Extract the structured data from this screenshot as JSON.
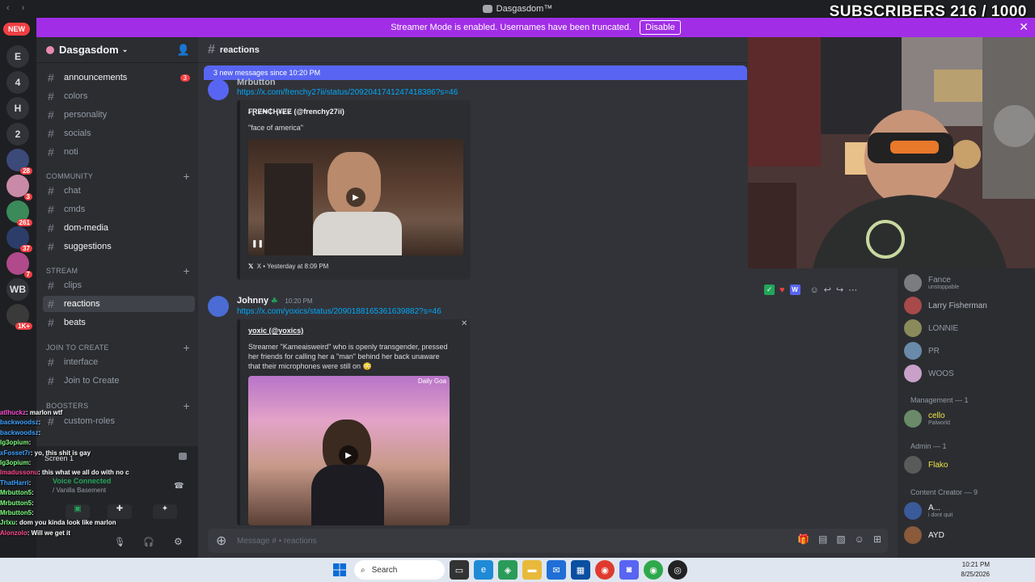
{
  "window": {
    "title": "Dasgasdom™"
  },
  "overlay": {
    "subscribers_text": "SUBSCRIBERS 216 / 1000"
  },
  "banner": {
    "text": "Streamer Mode is enabled. Usernames have been truncated.",
    "button": "Disable"
  },
  "rail": {
    "new_label": "NEW",
    "servers": [
      {
        "label": "E",
        "badge": ""
      },
      {
        "label": "4",
        "badge": ""
      },
      {
        "label": "H",
        "badge": ""
      },
      {
        "label": "2",
        "badge": ""
      },
      {
        "label": "",
        "badge": "28"
      },
      {
        "label": "",
        "badge": "3"
      },
      {
        "label": "",
        "badge": "261"
      },
      {
        "label": "",
        "badge": "37"
      },
      {
        "label": "",
        "badge": "7"
      },
      {
        "label": "WB",
        "badge": ""
      },
      {
        "label": "",
        "badge": "1K+"
      }
    ]
  },
  "sidebar": {
    "server_name": "Dasgasdom",
    "channels_top": [
      {
        "name": "announcements",
        "unread": true,
        "badge": "3"
      },
      {
        "name": "colors",
        "unread": false,
        "badge": ""
      },
      {
        "name": "personality",
        "unread": false,
        "badge": ""
      },
      {
        "name": "socials",
        "unread": false,
        "badge": ""
      },
      {
        "name": "noti",
        "unread": false,
        "badge": ""
      }
    ],
    "cat_community": "COMMUNITY",
    "channels_community": [
      {
        "name": "chat",
        "unread": false
      },
      {
        "name": "cmds",
        "unread": false
      },
      {
        "name": "dom-media",
        "unread": true
      },
      {
        "name": "suggestions",
        "unread": true
      }
    ],
    "cat_stream": "STREAM",
    "channels_stream": [
      {
        "name": "clips",
        "unread": false
      },
      {
        "name": "reactions",
        "unread": true,
        "active": true
      },
      {
        "name": "beats",
        "unread": true
      }
    ],
    "cat_join": "JOIN TO CREATE",
    "channels_join": [
      {
        "name": "interface"
      },
      {
        "name": "Join to Create"
      }
    ],
    "cat_boosters": "BOOSTERS",
    "channels_boosters": [
      {
        "name": "custom-roles"
      }
    ],
    "voice": {
      "screen": "Screen 1",
      "status": "Voice Connected",
      "channel": "/ Vanilla Basement"
    }
  },
  "chat": {
    "channel": "reactions",
    "new_messages": "3 new messages since 10:20 PM",
    "msg1": {
      "author": "Mrbutton",
      "link": "https://x.com/frenchy27ii/status/2092041741247418386?s=46",
      "embed_author": "₣ⱤɆ₦₵Ⱨ¥ɆɆ (@frenchy27ii)",
      "embed_desc": "\"face of america\"",
      "footer": "X • Yesterday at 8:09 PM"
    },
    "msg2": {
      "author": "Johnny",
      "time": "10:20 PM",
      "link": "https://x.com/yoxics/status/2090188165361639882?s=46",
      "embed_author": "yoxic (@yoxics)",
      "embed_desc": "Streamer \"Kameaisweird\" who is openly transgender, pressed her friends for calling her a \"man\" behind her back unaware that their microphones were still on 😳",
      "video_watermark": "Daily Goa"
    },
    "message_placeholder": "Message # • reactions"
  },
  "members": {
    "top": [
      {
        "name": "Fance",
        "sub": "unstoppable",
        "color": "#949ba4"
      },
      {
        "name": "Larry Fisherman",
        "sub": "",
        "color": "#b5bac1"
      },
      {
        "name": "LONNIE",
        "sub": "",
        "color": "#949ba4"
      },
      {
        "name": "PR",
        "sub": "",
        "color": "#949ba4"
      },
      {
        "name": "WOOS",
        "sub": "",
        "color": "#949ba4"
      }
    ],
    "role_management": "Management — 1",
    "management": [
      {
        "name": "cello",
        "sub": "Palworld",
        "color": "#f0e64a"
      }
    ],
    "role_admin": "Admin — 1",
    "admin": [
      {
        "name": "Flako",
        "sub": "",
        "color": "#f0e64a"
      }
    ],
    "role_creator": "Content Creator — 9",
    "creators": [
      {
        "name": "A...",
        "sub": "i dont quit",
        "color": "#f2f3f5"
      },
      {
        "name": "AYD",
        "sub": "",
        "color": "#f2f3f5"
      }
    ]
  },
  "twitch_chat": [
    {
      "user": "atlhuckz",
      "text": ": marlon wtf",
      "color": "#ff4ad2"
    },
    {
      "user": "backwoodsz",
      "text": ":",
      "color": "#3aa0ff"
    },
    {
      "user": "backwoodsz",
      "text": ":",
      "color": "#3aa0ff"
    },
    {
      "user": "lg3opium",
      "text": ":",
      "color": "#7cff7c"
    },
    {
      "user": "xFosset7r",
      "text": ": yo, this shit is gay",
      "color": "#3aa0ff"
    },
    {
      "user": "lg3opium",
      "text": ":",
      "color": "#7cff7c"
    },
    {
      "user": "lmadussonu",
      "text": ": this what we all do with no cams on",
      "color": "#ff4a8a"
    },
    {
      "user": "ThatHarri",
      "text": ":",
      "color": "#3aa0ff"
    },
    {
      "user": "Mrbutton5",
      "text": ":",
      "color": "#7cff7c"
    },
    {
      "user": "Mrbutton5",
      "text": ":",
      "color": "#7cff7c"
    },
    {
      "user": "Mrbutton5",
      "text": ":",
      "color": "#7cff7c"
    },
    {
      "user": "Jrlxu",
      "text": ": dom you kinda look like marlon",
      "color": "#7cff7c"
    },
    {
      "user": "Alonzolo",
      "text": ": Will we get it",
      "color": "#ff4a8a"
    }
  ],
  "taskbar": {
    "search": "Search",
    "time": "10:21 PM",
    "date": "8/25/2026"
  }
}
